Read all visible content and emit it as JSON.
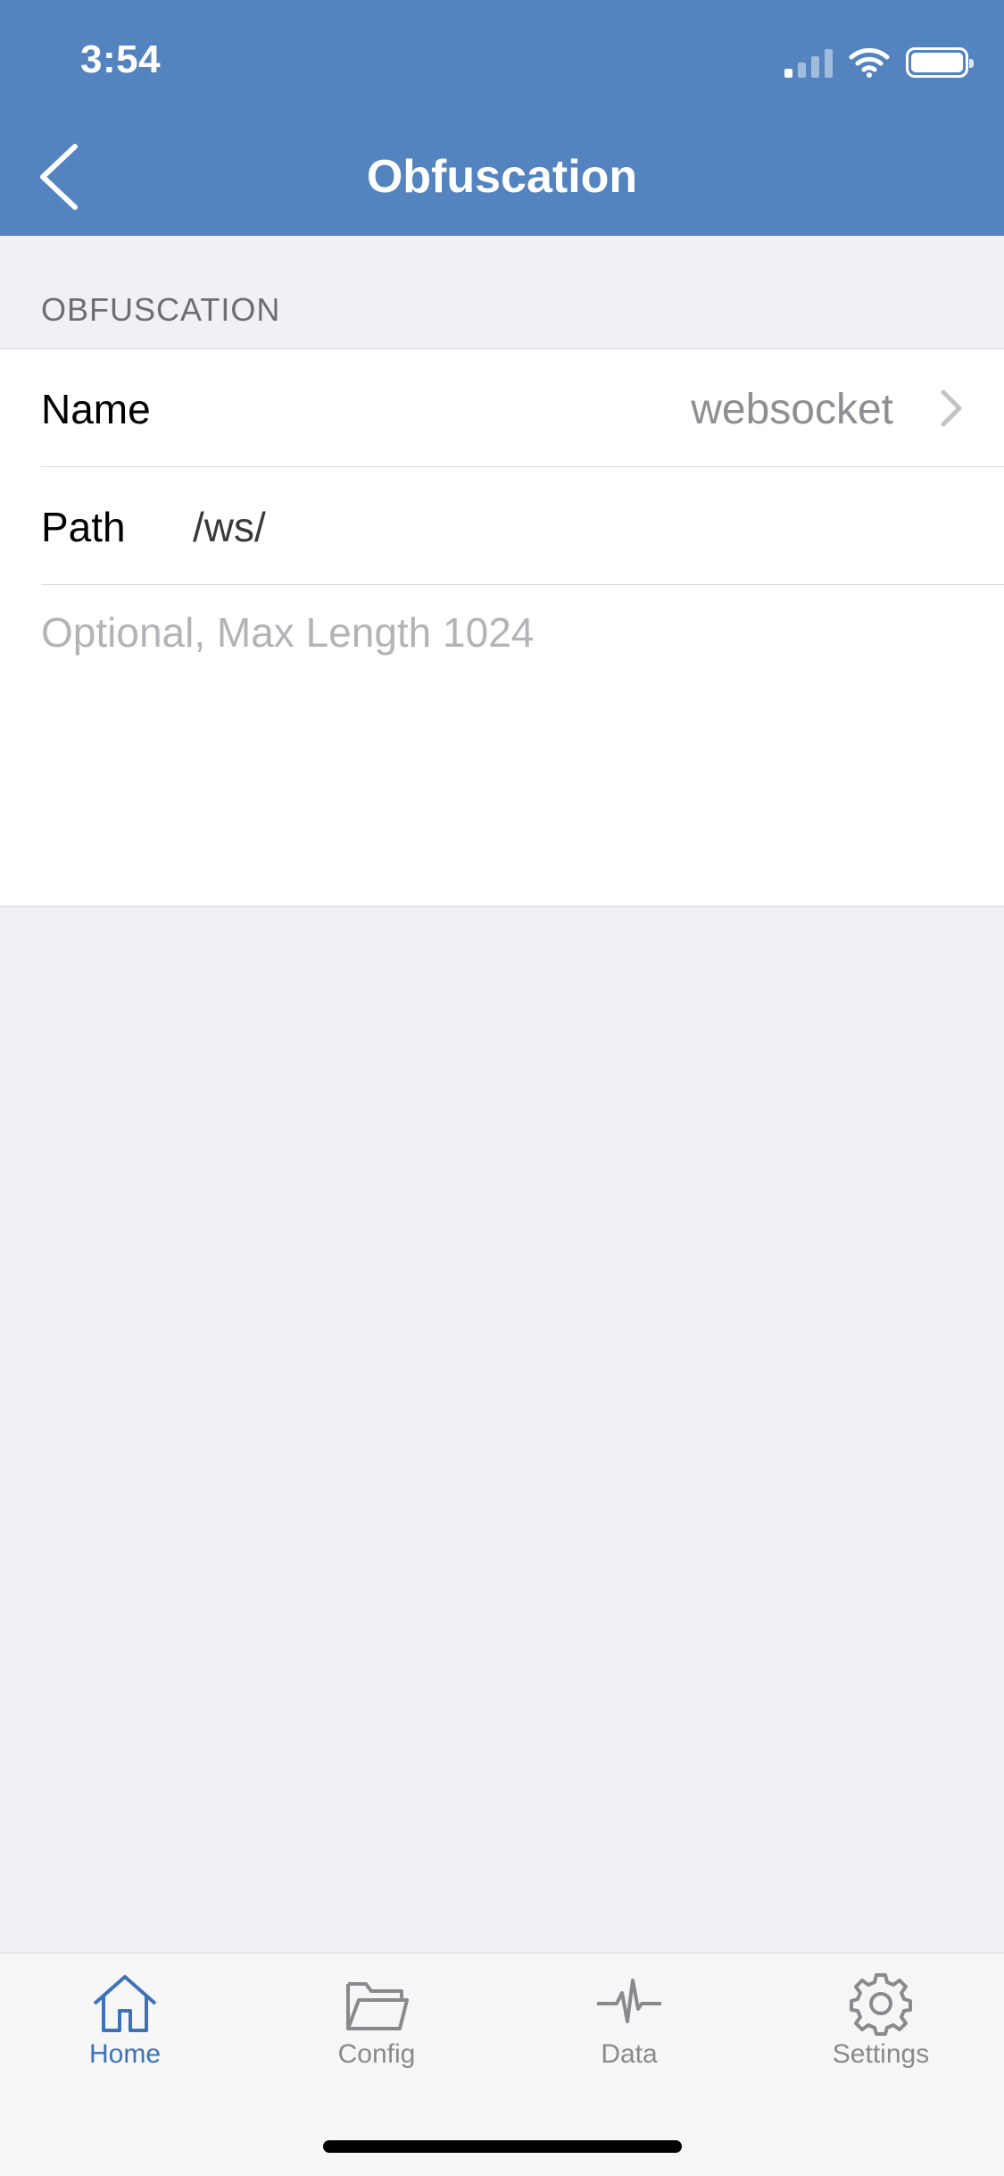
{
  "status_bar": {
    "time": "3:54"
  },
  "nav": {
    "title": "Obfuscation",
    "back_icon": "chevron-left-icon"
  },
  "section": {
    "header": "OBFUSCATION"
  },
  "form": {
    "name_label": "Name",
    "name_value": "websocket",
    "path_label": "Path",
    "path_value": "/ws/",
    "placeholder": "Optional, Max Length 1024"
  },
  "tabs": [
    {
      "label": "Home",
      "icon": "home-icon",
      "active": true
    },
    {
      "label": "Config",
      "icon": "folder-icon",
      "active": false
    },
    {
      "label": "Data",
      "icon": "pulse-icon",
      "active": false
    },
    {
      "label": "Settings",
      "icon": "gear-icon",
      "active": false
    }
  ],
  "colors": {
    "header": "#5384C0",
    "active_tab": "#3C72B8",
    "inactive_tab": "#8A8A8E",
    "background": "#F0F0F5"
  }
}
